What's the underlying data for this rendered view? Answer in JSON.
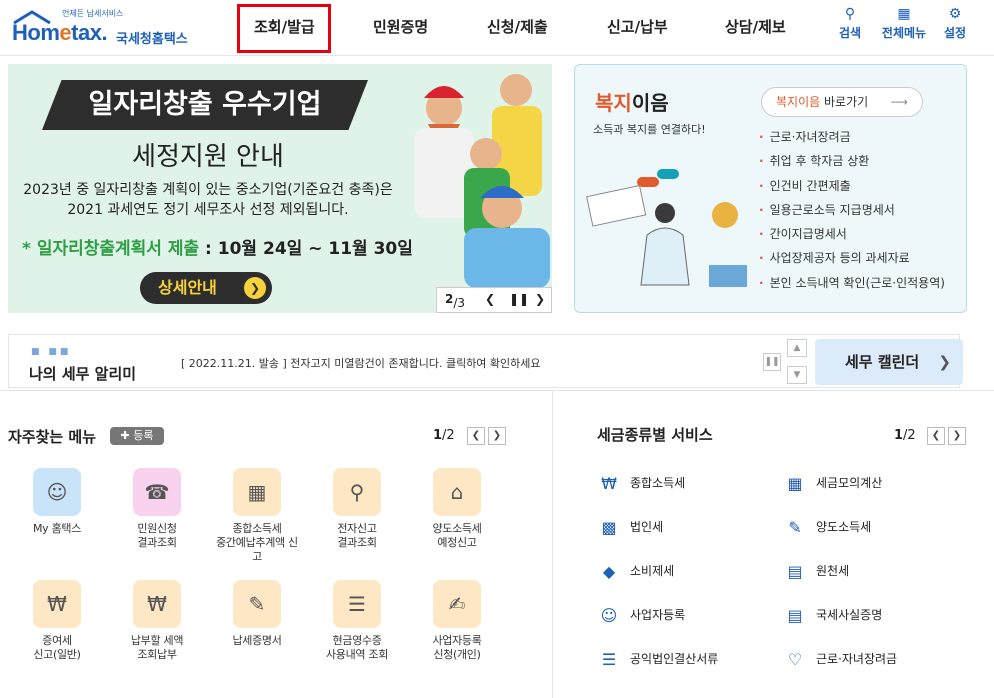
{
  "header": {
    "logo_sub": "언제든 납세서비스",
    "logo_brand_a": "Hom",
    "logo_brand_b": "e",
    "logo_brand_c": "tax.",
    "logo_kr": "국세청홈택스",
    "nav": [
      "조회/발급",
      "민원증명",
      "신청/제출",
      "신고/납부",
      "상담/제보"
    ],
    "tools": [
      {
        "icon": "search-icon",
        "label": "검색"
      },
      {
        "icon": "grid-menu-icon",
        "label": "전체메뉴"
      },
      {
        "icon": "gear-icon",
        "label": "설정"
      }
    ]
  },
  "banner": {
    "title": "일자리창출 우수기업",
    "subtitle": "세정지원 안내",
    "desc1": "2023년 중 일자리창출 계획이 있는 중소기업(기준요건 충족)은",
    "desc2": "2021 과세연도 정기 세무조사 선정 제외됩니다.",
    "period_prefix": "* ",
    "period_label": "일자리창출계획서 제출",
    "period_value": " : 10월 24일 ~ 11월 30일",
    "button": "상세안내",
    "page": "2",
    "total": "/3"
  },
  "welfare": {
    "title_a": "복지",
    "title_b": "이음",
    "subtitle": "소득과 복지를 연결하다!",
    "go_a": "복지이음",
    "go_b": " 바로가기",
    "items": [
      "근로·자녀장려금",
      "취업 후 학자금 상환",
      "인건비 간편제출",
      "일용근로소득 지급명세서",
      "간이지급명세서",
      "사업장제공자 등의 과세자료",
      "본인 소득내역 확인(근로·인적용역)"
    ]
  },
  "notice": {
    "title": "나의 세무 알리미",
    "message": "[ 2022.11.21. 발송 ] 전자고지 미열람건이 존재합니다. 클릭하여 확인하세요",
    "calendar": "세무 캘린더"
  },
  "favorites": {
    "title": "자주찾는 메뉴",
    "register": "등록",
    "page": "1",
    "total": "/2",
    "items": [
      {
        "l1": "My 홈택스",
        "l2": "",
        "l3": "",
        "color": "#c9e3f8"
      },
      {
        "l1": "민원신청",
        "l2": "결과조회",
        "l3": "",
        "color": "#f8d2ef"
      },
      {
        "l1": "종합소득세",
        "l2": "중간예납추계액 신",
        "l3": "고",
        "color": "#fde7c4"
      },
      {
        "l1": "전자신고",
        "l2": "결과조회",
        "l3": "",
        "color": "#fde7c4"
      },
      {
        "l1": "양도소득세",
        "l2": "예정신고",
        "l3": "",
        "color": "#fde7c4"
      },
      {
        "l1": "증여세",
        "l2": "신고(일반)",
        "l3": "",
        "color": "#fde7c4"
      },
      {
        "l1": "납부할 세액",
        "l2": "조회납부",
        "l3": "",
        "color": "#fde7c4"
      },
      {
        "l1": "납세증명서",
        "l2": "",
        "l3": "",
        "color": "#fde7c4"
      },
      {
        "l1": "현금영수증",
        "l2": "사용내역 조회",
        "l3": "",
        "color": "#fde7c4"
      },
      {
        "l1": "사업자등록",
        "l2": "신청(개인)",
        "l3": "",
        "color": "#fde7c4"
      }
    ]
  },
  "services": {
    "title": "세금종류별 서비스",
    "page": "1",
    "total": "/2",
    "items": [
      "종합소득세",
      "세금모의계산",
      "법인세",
      "양도소득세",
      "소비제세",
      "원천세",
      "사업자등록",
      "국세사실증명",
      "공익법인결산서류",
      "근로·자녀장려금"
    ]
  }
}
